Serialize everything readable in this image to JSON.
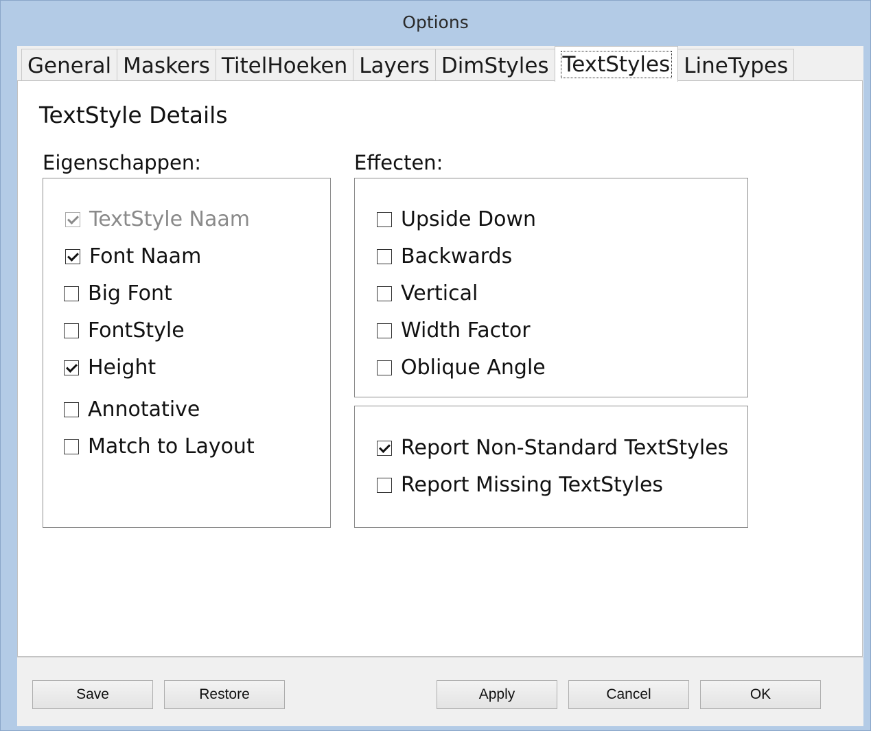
{
  "window": {
    "title": "Options"
  },
  "tabs": [
    {
      "label": "General"
    },
    {
      "label": "Maskers"
    },
    {
      "label": "TitelHoeken"
    },
    {
      "label": "Layers"
    },
    {
      "label": "DimStyles"
    },
    {
      "label": "TextStyles"
    },
    {
      "label": "LineTypes"
    }
  ],
  "panel": {
    "heading": "TextStyle Details",
    "eigenschappen": {
      "label": "Eigenschappen:",
      "items": [
        {
          "label": "TextStyle Naam",
          "checked": true,
          "disabled": true
        },
        {
          "label": "Font Naam",
          "checked": true
        },
        {
          "label": "Big Font",
          "checked": false
        },
        {
          "label": "FontStyle",
          "checked": false
        },
        {
          "label": "Height",
          "checked": true
        },
        {
          "label": "Annotative",
          "checked": false
        },
        {
          "label": "Match to Layout",
          "checked": false
        }
      ]
    },
    "effecten": {
      "label": "Effecten:",
      "items": [
        {
          "label": "Upside Down",
          "checked": false
        },
        {
          "label": "Backwards",
          "checked": false
        },
        {
          "label": "Vertical",
          "checked": false
        },
        {
          "label": "Width Factor",
          "checked": false
        },
        {
          "label": "Oblique Angle",
          "checked": false
        }
      ]
    },
    "report": {
      "items": [
        {
          "label": "Report Non-Standard TextStyles",
          "checked": true
        },
        {
          "label": "Report Missing TextStyles",
          "checked": false
        }
      ]
    }
  },
  "buttons": {
    "save": "Save",
    "restore": "Restore",
    "apply": "Apply",
    "cancel": "Cancel",
    "ok": "OK"
  }
}
